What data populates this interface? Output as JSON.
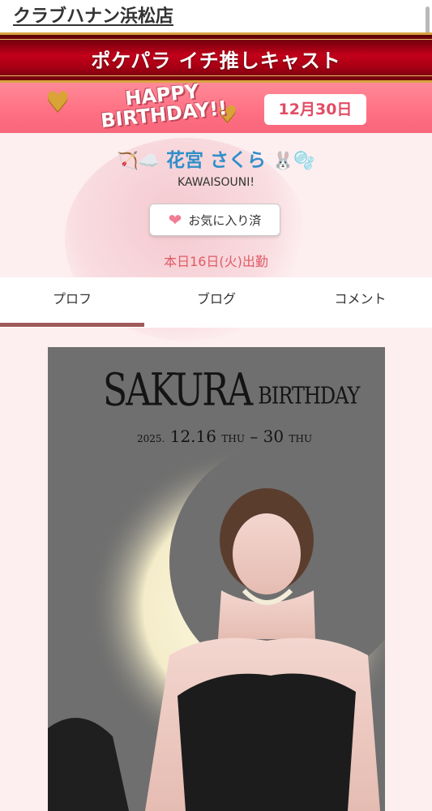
{
  "store": {
    "name": "クラブハナン浜松店"
  },
  "banner": {
    "title": "ポケパラ イチ推しキャスト"
  },
  "birthday": {
    "text_line1": "HAPPY",
    "text_line2": "BIRTHDAY!!",
    "date": "12月30日"
  },
  "cast": {
    "name_prefix_emoji": "🏹☁️",
    "name": "花宮 さくら",
    "name_suffix_emoji": "🐰🫧",
    "subtitle": "KAWAISOUNI!",
    "favorite_label": "お気に入り済",
    "schedule": "本日16日(火)出勤"
  },
  "tabs": [
    {
      "label": "プロフ",
      "active": true
    },
    {
      "label": "ブログ",
      "active": false
    },
    {
      "label": "コメント",
      "active": false
    }
  ],
  "poster": {
    "title_main": "SAKURA",
    "title_sub": "BIRTHDAY",
    "date_year": "2025.",
    "date_start": "12.16",
    "date_start_day": "THU",
    "date_sep": "–",
    "date_end": "30",
    "date_end_day": "THU"
  },
  "colors": {
    "accent_red": "#c3001a",
    "pink": "#ff6f83",
    "name_blue": "#2f8fc9",
    "tab_indicator": "#a05a5a"
  }
}
